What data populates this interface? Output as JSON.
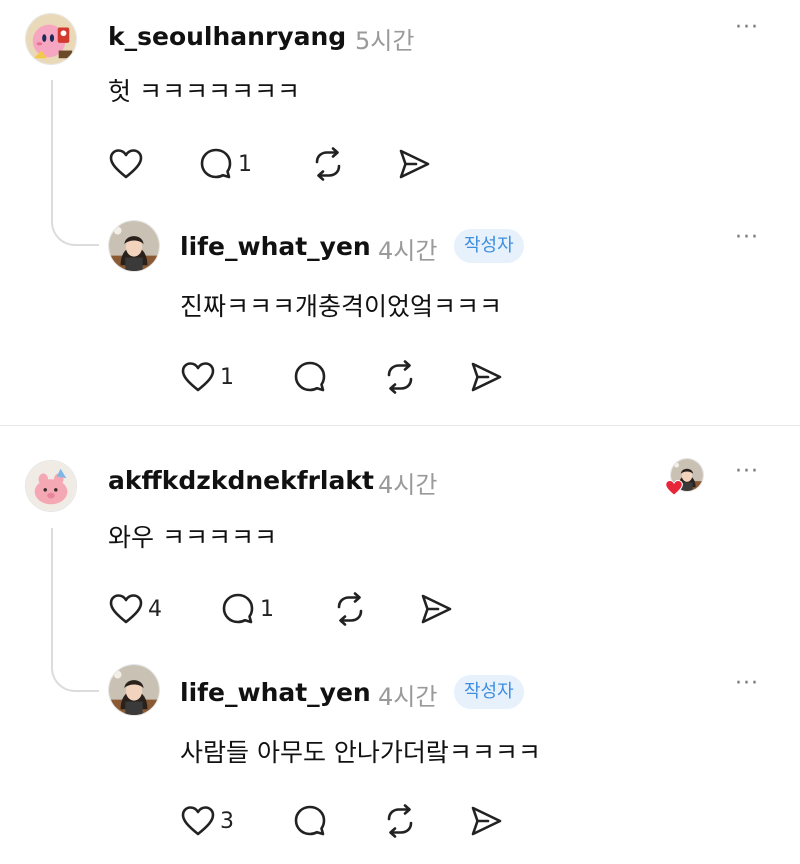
{
  "icons": {
    "like": "heart-icon",
    "reply": "comment-icon",
    "repost": "repost-icon",
    "share": "send-icon",
    "more": "more-dots-icon",
    "liked_by_author": "heart-filled-icon"
  },
  "colors": {
    "accent_badge_bg": "#e7f1fb",
    "accent_badge_text": "#3d8ee0",
    "heart_red": "#e8263a"
  },
  "comments": [
    {
      "username": "k_seoulhanryang",
      "time": "5시간",
      "text": "헛 ㅋㅋㅋㅋㅋㅋㅋ",
      "reply_count": "1",
      "more": "···",
      "reply": {
        "username": "life_what_yen",
        "time": "4시간",
        "badge": "작성자",
        "text": "진짜ㅋㅋㅋ개충격이었엌ㅋㅋㅋ",
        "like_count": "1",
        "more": "···"
      }
    },
    {
      "username": "akffkdzkdnekfrlakt",
      "time": "4시간",
      "text": "와우 ㅋㅋㅋㅋㅋ",
      "like_count": "4",
      "reply_count": "1",
      "more": "···",
      "reply": {
        "username": "life_what_yen",
        "time": "4시간",
        "badge": "작성자",
        "text": "사람들 아무도 안나가더랔ㅋㅋㅋㅋ",
        "like_count": "3",
        "more": "···"
      }
    }
  ]
}
